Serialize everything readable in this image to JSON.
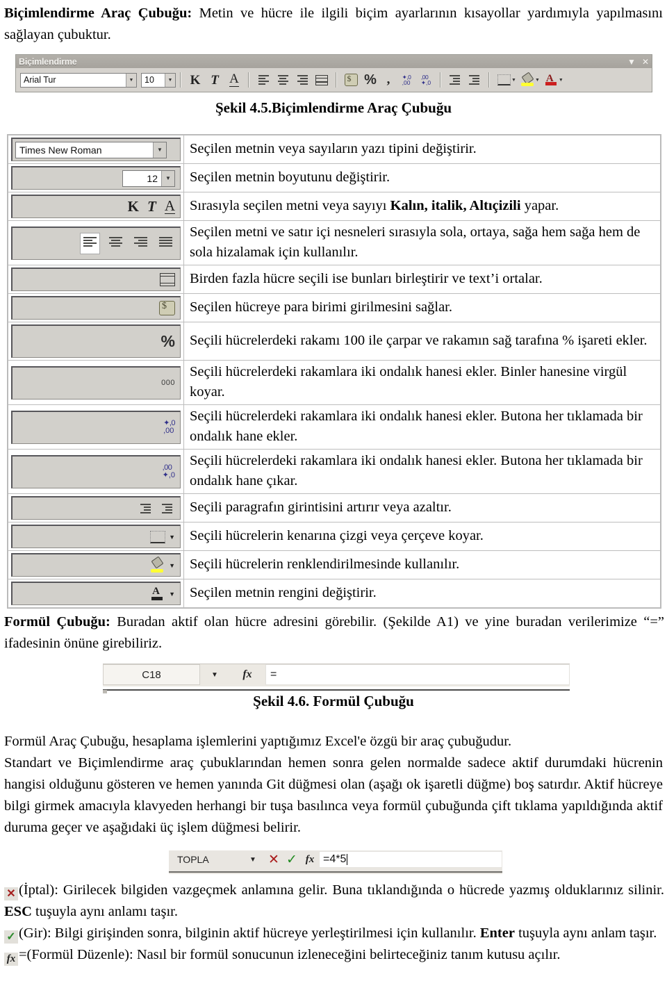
{
  "intro": {
    "lead": "Biçimlendirme Araç Çubuğu:",
    "text": " Metin ve hücre ile ilgili biçim ayarlarının kısayollar yardımıyla yapılmasını sağlayan çubuktur."
  },
  "format_toolbar": {
    "title": "Biçimlendirme",
    "minimize_label": "▼",
    "close_label": "✕",
    "font_name": "Arial Tur",
    "font_size": "10",
    "bold_label": "K",
    "italic_label": "T",
    "underline_label": "A",
    "percent_label": "%",
    "comma_label": ","
  },
  "captions": {
    "fig45": "Şekil 4.5.Biçimlendirme Araç Çubuğu",
    "fig46": "Şekil 4.6. Formül Çubuğu"
  },
  "table": {
    "rows": [
      {
        "icon": "font-name-combo",
        "value": "Times New Roman",
        "desc": "Seçilen metnin veya sayıların yazı tipini değiştirir."
      },
      {
        "icon": "font-size-combo",
        "value": "12",
        "desc": "Seçilen metnin boyutunu değiştirir."
      },
      {
        "icon": "bold-italic-underline",
        "value": "K T A",
        "desc_pre": "Sırasıyla seçilen metni veya sayıyı ",
        "desc_bold": "Kalın, italik, Altıçizili",
        "desc_post": " yapar."
      },
      {
        "icon": "alignment-buttons",
        "value": "",
        "desc": "Seçilen metni ve satır içi nesneleri sırasıyla sola, ortaya, sağa hem sağa hem de sola hizalamak için kullanılır."
      },
      {
        "icon": "merge-and-center",
        "value": "",
        "desc": "Birden fazla hücre seçili ise bunları birleştirir ve text’i ortalar."
      },
      {
        "icon": "currency-style",
        "value": "",
        "desc": "Seçilen hücreye para birimi girilmesini sağlar."
      },
      {
        "icon": "percent-style",
        "value": "%",
        "desc": "Seçili hücrelerdeki rakamı 100 ile çarpar ve rakamın sağ tarafına % işareti ekler."
      },
      {
        "icon": "comma-style",
        "value": "000",
        "desc": "Seçili hücrelerdeki rakamlara iki ondalık hanesi ekler. Binler hanesine virgül koyar."
      },
      {
        "icon": "increase-decimal",
        "value": "+,0 ,00",
        "desc": "Seçili hücrelerdeki rakamlara iki ondalık hanesi ekler. Butona her tıklamada bir ondalık hane ekler."
      },
      {
        "icon": "decrease-decimal",
        "value": ",00 +,0",
        "desc": "Seçili hücrelerdeki rakamlara iki ondalık hanesi ekler. Butona her tıklamada bir ondalık hane çıkar."
      },
      {
        "icon": "indent-buttons",
        "value": "",
        "desc": "Seçili paragrafın girintisini artırır veya azaltır."
      },
      {
        "icon": "borders-dropdown",
        "value": "",
        "desc": "Seçili hücrelerin kenarına çizgi veya çerçeve koyar."
      },
      {
        "icon": "fill-color-dropdown",
        "value": "",
        "desc": "Seçili hücrelerin renklendirilmesinde kullanılır."
      },
      {
        "icon": "font-color-dropdown",
        "value": "",
        "desc": "Seçilen metnin rengini değiştirir."
      }
    ]
  },
  "formula_section": {
    "lead": "Formül Çubuğu:",
    "text": " Buradan aktif olan hücre adresini görebilir. (Şekilde A1) ve yine buradan verilerimize “=” ifadesinin önüne girebiliriz."
  },
  "formula_bar": {
    "cell_ref": "C18",
    "dropdown_label": "▼",
    "fx_label": "fx",
    "input_value": "="
  },
  "body_paragraph": {
    "line1": "Formül Araç Çubuğu, hesaplama işlemlerini yaptığımız Excel'e özgü bir araç çubuğudur.",
    "line2": "Standart ve Biçimlendirme araç çubuklarından hemen sonra gelen normalde sadece aktif durumdaki hücrenin hangisi olduğunu gösteren ve hemen yanında Git düğmesi olan (aşağı ok işaretli düğme) boş satırdır. Aktif hücreye bilgi girmek amacıyla klavyeden herhangi bir tuşa basılınca veya formül çubuğunda çift tıklama yapıldığında aktif duruma geçer ve aşağıdaki üç işlem düğmesi belirir."
  },
  "topla_bar": {
    "name": "TOPLA",
    "dropdown_label": "▼",
    "cancel_label": "✕",
    "enter_label": "✓",
    "fx_label": "fx",
    "input_value": "=4*5"
  },
  "explanations": [
    {
      "icon": "cancel-icon",
      "glyph": "✕",
      "pre": "(İptal): Girilecek bilgiden vazgeçmek anlamına gelir. Buna tıklandığında o hücrede yazmış olduklarınız silinir. ",
      "bold": "ESC",
      "post": " tuşuyla aynı anlamı taşır."
    },
    {
      "icon": "enter-icon",
      "glyph": "✓",
      "pre": "(Gir): Bilgi girişinden sonra, bilginin aktif hücreye yerleştirilmesi için kullanılır. ",
      "bold": "Enter",
      "post": " tuşuyla aynı anlam taşır."
    },
    {
      "icon": "formula-edit-icon",
      "glyph": "fx",
      "pre": "=(Formül Düzenle): Nasıl bir formül sonucunun izleneceğini belirteceğiniz tanım kutusu açılır.",
      "bold": "",
      "post": ""
    }
  ]
}
